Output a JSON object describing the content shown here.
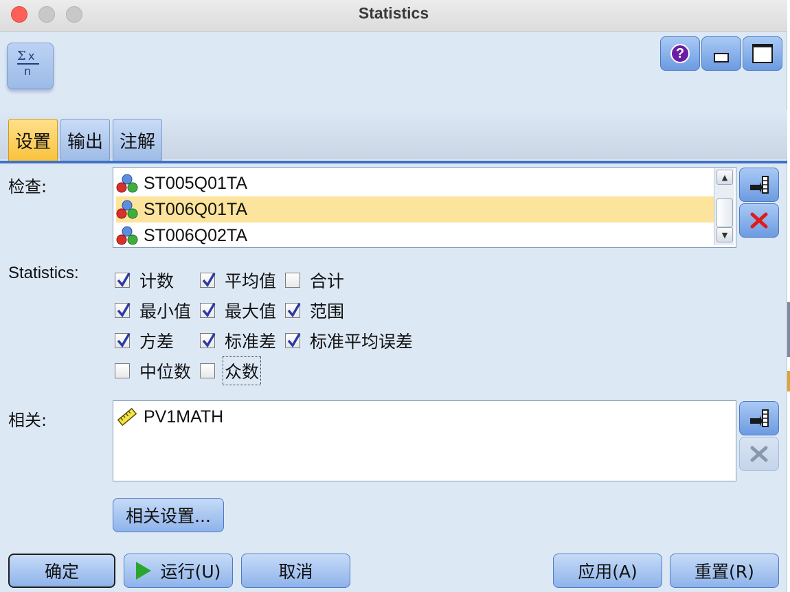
{
  "window": {
    "title": "Statistics"
  },
  "tabs": [
    {
      "label": "设置",
      "active": true
    },
    {
      "label": "输出",
      "active": false
    },
    {
      "label": "注解",
      "active": false
    }
  ],
  "examine": {
    "label": "检查:",
    "items": [
      {
        "label": "ST005Q01TA",
        "selected": false,
        "icon": "nominal-field-icon"
      },
      {
        "label": "ST006Q01TA",
        "selected": true,
        "icon": "nominal-field-icon"
      },
      {
        "label": "ST006Q02TA",
        "selected": false,
        "icon": "nominal-field-icon"
      }
    ]
  },
  "statistics": {
    "label": "Statistics:",
    "options": [
      {
        "label": "计数",
        "checked": true
      },
      {
        "label": "平均值",
        "checked": true
      },
      {
        "label": "合计",
        "checked": false
      },
      {
        "label": "最小值",
        "checked": true
      },
      {
        "label": "最大值",
        "checked": true
      },
      {
        "label": "范围",
        "checked": true
      },
      {
        "label": "方差",
        "checked": true
      },
      {
        "label": "标准差",
        "checked": true
      },
      {
        "label": "标准平均误差",
        "checked": true
      },
      {
        "label": "中位数",
        "checked": false
      },
      {
        "label": "众数",
        "checked": false
      }
    ]
  },
  "correlate": {
    "label": "相关:",
    "items": [
      {
        "label": "PV1MATH",
        "icon": "continuous-field-icon"
      }
    ],
    "settings_button": "相关设置..."
  },
  "footer": {
    "ok": "确定",
    "run": "运行(U)",
    "cancel": "取消",
    "apply": "应用(A)",
    "reset": "重置(R)"
  },
  "colors": {
    "accent": "#3f72c4",
    "selection": "#fde49c",
    "active_tab": "#f9c23c",
    "delete": "#e01b1b",
    "help": "#6a1ea3"
  }
}
